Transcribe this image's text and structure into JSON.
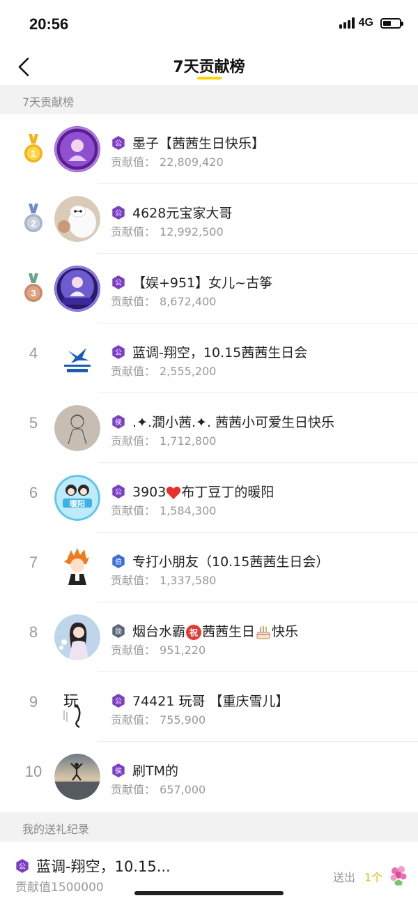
{
  "status_bar": {
    "time": "20:56",
    "network": "4G"
  },
  "nav": {
    "title": "7天贡献榜"
  },
  "sections": {
    "leaderboard_header": "7天贡献榜",
    "my_record_header": "我的送礼纪录"
  },
  "score_label": "贡献值：",
  "colors": {
    "accent": "#FFD400",
    "badge_purple": "#7B3FC4",
    "badge_blue": "#3B6FD6",
    "badge_gray": "#5A6478",
    "gold": "#F3B21A",
    "silver": "#A9B4C8",
    "bronze": "#C98A6A"
  },
  "leaderboard": [
    {
      "rank": "1",
      "name": "墨子【茜茜生日快乐】",
      "score": "22,809,420",
      "badge_text": "公",
      "badge_color": "#7B3FC4",
      "avatar_icon": "purple-girl-avatar"
    },
    {
      "rank": "2",
      "name": "4628元宝家大哥",
      "score": "12,992,500",
      "badge_text": "公",
      "badge_color": "#7B3FC4",
      "avatar_icon": "white-robot-avatar"
    },
    {
      "rank": "3",
      "name": "【娱+951】女儿~古筝",
      "score": "8,672,400",
      "badge_text": "公",
      "badge_color": "#7B3FC4",
      "avatar_icon": "purple-frame-avatar"
    },
    {
      "rank": "4",
      "name": "蓝调-翔空，10.15茜茜生日会",
      "score": "2,555,200",
      "badge_text": "公",
      "badge_color": "#7B3FC4",
      "avatar_icon": "blues-media-logo"
    },
    {
      "rank": "5",
      "name": ".✦.潤小茜.✦. 茜茜小可爱生日快乐",
      "score": "1,712,800",
      "badge_text": "侯",
      "badge_color": "#7B3FC4",
      "avatar_icon": "sketch-avatar"
    },
    {
      "rank": "6",
      "name_parts": [
        "3903",
        "布丁豆丁的暖阳"
      ],
      "score": "1,584,300",
      "badge_text": "公",
      "badge_color": "#7B3FC4",
      "avatar_icon": "two-girls-avatar",
      "avatar_text": "暖阳"
    },
    {
      "rank": "7",
      "name": "专打小朋友（10.15茜茜生日会）",
      "score": "1,337,580",
      "badge_text": "伯",
      "badge_color": "#3B6FD6",
      "avatar_icon": "anime-boy-avatar"
    },
    {
      "rank": "8",
      "name_parts": [
        "烟台水霸",
        "茜茜生日",
        "快乐"
      ],
      "score": "951,220",
      "badge_text": "勋",
      "badge_color": "#5A6478",
      "avatar_icon": "woman-photo-avatar",
      "blessing_text": "祝"
    },
    {
      "rank": "9",
      "name": "74421 玩哥 【重庆雪儿】",
      "score": "755,900",
      "badge_text": "公",
      "badge_color": "#7B3FC4",
      "avatar_icon": "calligraphy-avatar",
      "avatar_text": "玩"
    },
    {
      "rank": "10",
      "name": "刷TM的",
      "score": "657,000",
      "badge_text": "侯",
      "badge_color": "#7B3FC4",
      "avatar_icon": "sunset-jump-avatar"
    }
  ],
  "my_record": {
    "name": "蓝调-翔空，10.15...",
    "score_text": "贡献值1500000",
    "badge_text": "公",
    "sent_label": "送出",
    "sent_count": "1个",
    "gift_icon": "flower-gift-icon"
  }
}
